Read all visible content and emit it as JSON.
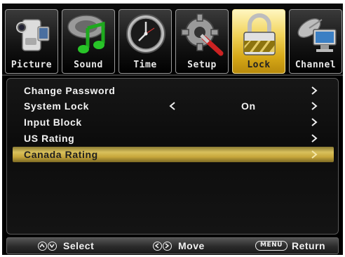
{
  "tabs": [
    {
      "label": "Picture",
      "icon": "camcorder-icon",
      "active": false
    },
    {
      "label": "Sound",
      "icon": "music-note-icon",
      "active": false
    },
    {
      "label": "Time",
      "icon": "clock-icon",
      "active": false
    },
    {
      "label": "Setup",
      "icon": "gear-wrench-icon",
      "active": false
    },
    {
      "label": "Lock",
      "icon": "padlock-icon",
      "active": true
    },
    {
      "label": "Channel",
      "icon": "satellite-dish-icon",
      "active": false
    }
  ],
  "menu": {
    "items": [
      {
        "label": "Change Password",
        "value": "",
        "selected": false
      },
      {
        "label": "System Lock",
        "value": "On",
        "selected": false
      },
      {
        "label": "Input Block",
        "value": "",
        "selected": false
      },
      {
        "label": "US Rating",
        "value": "",
        "selected": false
      },
      {
        "label": "Canada Rating",
        "value": "",
        "selected": true
      }
    ]
  },
  "footer": {
    "select_label": "Select",
    "move_label": "Move",
    "menu_key": "MENU",
    "return_label": "Return"
  },
  "colors": {
    "accent": "#d8c05c",
    "background": "#000000",
    "text": "#f2f2f2"
  }
}
